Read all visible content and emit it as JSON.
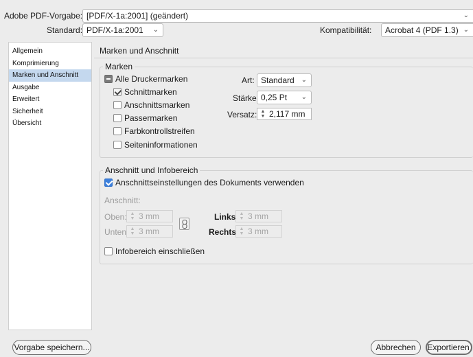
{
  "header": {
    "preset_label": "Adobe PDF-Vorgabe:",
    "preset_value": "[PDF/X-1a:2001] (geändert)",
    "standard_label": "Standard:",
    "standard_value": "PDF/X-1a:2001",
    "compat_label": "Kompatibilität:",
    "compat_value": "Acrobat 4 (PDF 1.3)"
  },
  "sidebar": {
    "items": [
      {
        "label": "Allgemein"
      },
      {
        "label": "Komprimierung"
      },
      {
        "label": "Marken und Anschnitt",
        "active": true
      },
      {
        "label": "Ausgabe"
      },
      {
        "label": "Erweitert"
      },
      {
        "label": "Sicherheit"
      },
      {
        "label": "Übersicht"
      }
    ]
  },
  "panel": {
    "title": "Marken und Anschnitt",
    "marks": {
      "group_title": "Marken",
      "all_marks": "Alle Druckermarken",
      "crop_marks": "Schnittmarken",
      "bleed_marks": "Anschnittsmarken",
      "registration_marks": "Passermarken",
      "color_bars": "Farbkontrollstreifen",
      "page_info": "Seiteninformationen",
      "type_label": "Art:",
      "type_value": "Standard",
      "weight_label": "Stärke:",
      "weight_value": "0,25 Pt",
      "offset_label": "Versatz:",
      "offset_value": "2,117 mm"
    },
    "bleed": {
      "group_title": "Anschnitt und Infobereich",
      "use_doc": "Anschnittseinstellungen des Dokuments verwenden",
      "bleed_label": "Anschnitt:",
      "top_label": "Oben:",
      "top_value": "3 mm",
      "bottom_label": "Unten:",
      "bottom_value": "3 mm",
      "left_label": "Links:",
      "left_value": "3 mm",
      "right_label": "Rechts:",
      "right_value": "3 mm",
      "slug": "Infobereich einschließen"
    }
  },
  "footer": {
    "save_preset": "Vorgabe speichern...",
    "cancel": "Abbrechen",
    "export": "Exportieren"
  },
  "colors": {
    "accent": "#3b7fdc",
    "sidebar_active": "#c4d8ee"
  }
}
